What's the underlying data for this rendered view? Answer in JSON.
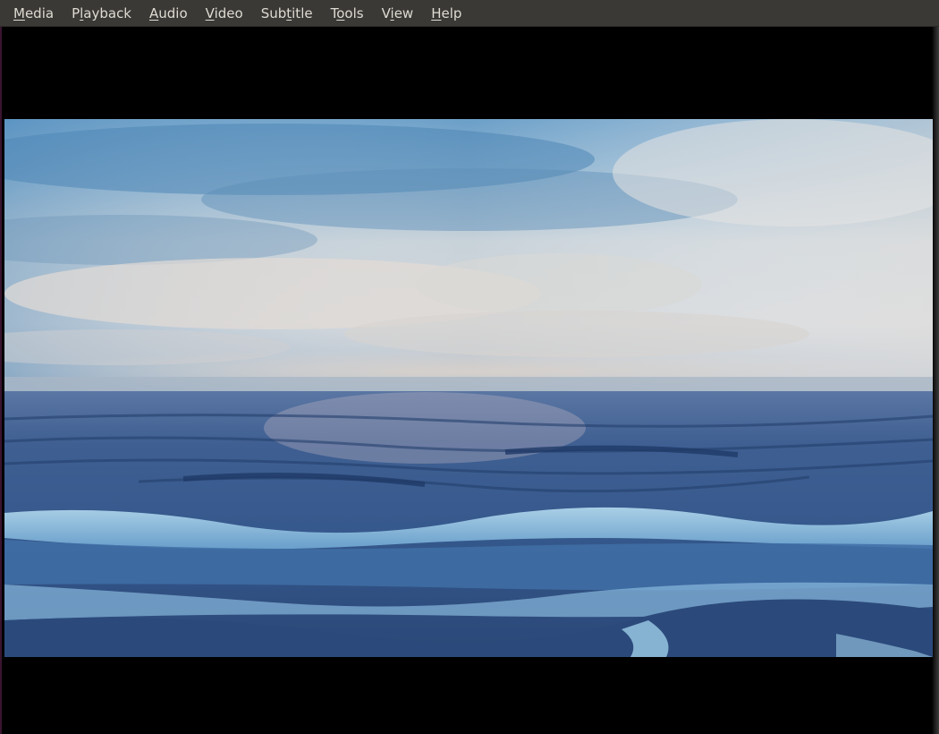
{
  "menubar": {
    "items": [
      {
        "pre": "",
        "mnemonic": "M",
        "post": "edia"
      },
      {
        "pre": "P",
        "mnemonic": "l",
        "post": "ayback"
      },
      {
        "pre": "",
        "mnemonic": "A",
        "post": "udio"
      },
      {
        "pre": "",
        "mnemonic": "V",
        "post": "ideo"
      },
      {
        "pre": "Sub",
        "mnemonic": "t",
        "post": "itle"
      },
      {
        "pre": "T",
        "mnemonic": "o",
        "post": "ols"
      },
      {
        "pre": "V",
        "mnemonic": "i",
        "post": "ew"
      },
      {
        "pre": "",
        "mnemonic": "H",
        "post": "elp"
      }
    ]
  },
  "video": {
    "scene": "ocean-waves-under-cloudy-sky",
    "colors": {
      "sky_top": "#5b93c0",
      "sky_mid": "#c9d3da",
      "horizon": "#b4c0cc",
      "sea_far": "#3d5d8e",
      "sea_near": "#2b4a7e",
      "foam": "#a8d0ea"
    }
  }
}
